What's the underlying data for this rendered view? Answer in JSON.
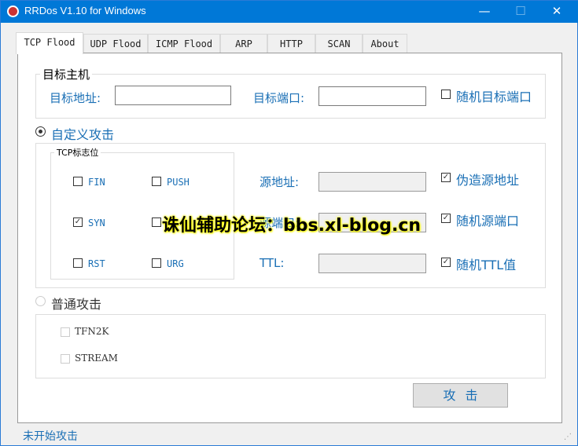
{
  "window": {
    "title": "RRDos V1.10 for Windows",
    "minimize": "—",
    "maximize": "☐",
    "close": "✕"
  },
  "tabs": [
    {
      "label": "TCP Flood"
    },
    {
      "label": "UDP Flood"
    },
    {
      "label": "ICMP Flood"
    },
    {
      "label": "ARP"
    },
    {
      "label": "HTTP"
    },
    {
      "label": "SCAN"
    },
    {
      "label": "About"
    }
  ],
  "target": {
    "group_title": "目标主机",
    "addr_label": "目标地址:",
    "addr_value": "",
    "port_label": "目标端口:",
    "port_value": "",
    "random_port_label": "随机目标端口",
    "random_port_checked": false
  },
  "custom": {
    "label": "自定义攻击",
    "selected": true,
    "flags_title": "TCP标志位",
    "flags": [
      {
        "label": "FIN",
        "checked": false
      },
      {
        "label": "PUSH",
        "checked": false
      },
      {
        "label": "SYN",
        "checked": true
      },
      {
        "label": "",
        "checked": false
      },
      {
        "label": "RST",
        "checked": false
      },
      {
        "label": "URG",
        "checked": false
      }
    ],
    "src_addr_label": "源地址:",
    "src_port_label": "源端口:",
    "ttl_label": "TTL:",
    "spoof_label": "伪造源地址",
    "spoof_checked": true,
    "random_src_port_label": "随机源端口",
    "random_src_port_checked": true,
    "random_ttl_label": "随机TTL值",
    "random_ttl_checked": true
  },
  "normal": {
    "label": "普通攻击",
    "selected": false,
    "options": [
      {
        "label": "TFN2K"
      },
      {
        "label": "STREAM"
      }
    ]
  },
  "attack_button": "攻击",
  "status": "未开始攻击",
  "watermark": "诛仙辅助论坛：bbs.xl-blog.cn",
  "accent": "#0078d7"
}
